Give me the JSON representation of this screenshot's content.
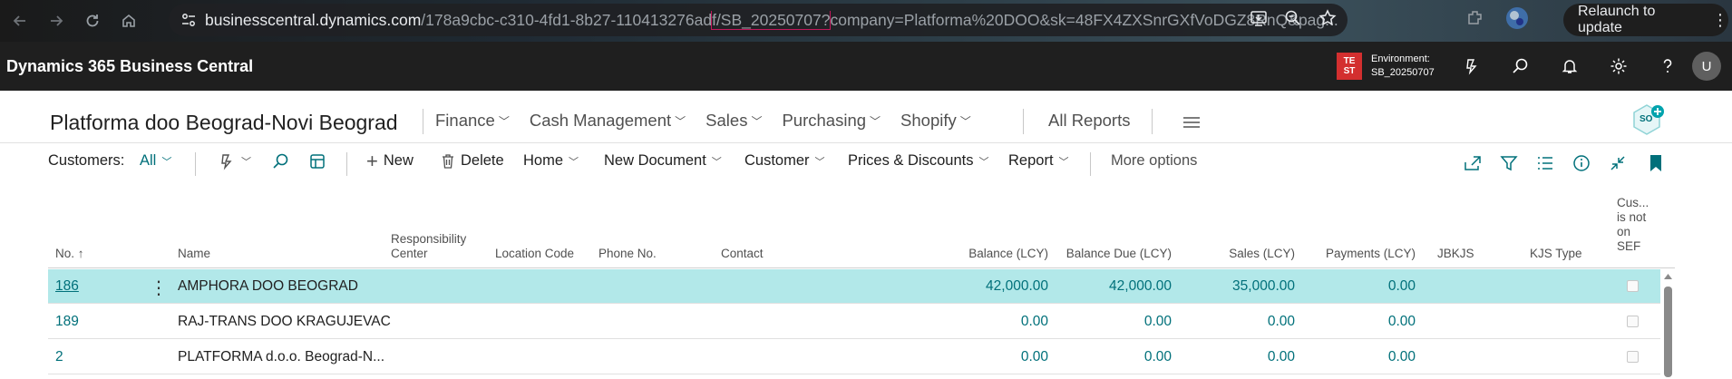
{
  "browser": {
    "url_host": "businesscentral.dynamics.com",
    "url_path_pre": "/178a9cbc-c310-4fd1-8b27-110413276ad",
    "url_highlight": "f/SB_20250707?",
    "url_path_post": "company=Platforma%20DOO&sk=48FX4ZXSnrGXfVoDGZ8RnQ&pag...",
    "relaunch_label": "Relaunch to update"
  },
  "appbar": {
    "app_name": "Dynamics 365 Business Central",
    "env_badge_line1": "TE",
    "env_badge_line2": "ST",
    "env_label": "Environment:",
    "env_name": "SB_20250707",
    "avatar_letter": "U"
  },
  "company_nav": {
    "company": "Platforma doo Beograd-Novi Beograd",
    "menu": [
      "Finance",
      "Cash Management",
      "Sales",
      "Purchasing",
      "Shopify"
    ],
    "all_reports": "All Reports",
    "badge": "SO"
  },
  "actionbar": {
    "title": "Customers:",
    "filter": "All",
    "new": "New",
    "delete": "Delete",
    "home": "Home",
    "new_document": "New Document",
    "customer": "Customer",
    "prices_discounts": "Prices & Discounts",
    "report": "Report",
    "more_options": "More options"
  },
  "columns": {
    "no": "No. ↑",
    "name": "Name",
    "resp_center_1": "Responsibility",
    "resp_center_2": "Center",
    "location": "Location Code",
    "phone": "Phone No.",
    "contact": "Contact",
    "balance": "Balance (LCY)",
    "balance_due": "Balance Due (LCY)",
    "sales": "Sales (LCY)",
    "payments": "Payments (LCY)",
    "jbkjs": "JBKJS",
    "kjs_type": "KJS Type",
    "sef_1": "Cus...",
    "sef_2": "is not",
    "sef_3": "on",
    "sef_4": "SEF"
  },
  "rows": [
    {
      "no": "186",
      "name": "AMPHORA DOO BEOGRAD",
      "balance": "42,000.00",
      "balance_due": "42,000.00",
      "sales": "35,000.00",
      "payments": "0.00"
    },
    {
      "no": "189",
      "name": "RAJ-TRANS DOO KRAGUJEVAC",
      "balance": "0.00",
      "balance_due": "0.00",
      "sales": "0.00",
      "payments": "0.00"
    },
    {
      "no": "2",
      "name": "PLATFORMA d.o.o. Beograd-N...",
      "balance": "0.00",
      "balance_due": "0.00",
      "sales": "0.00",
      "payments": "0.00"
    }
  ],
  "colors": {
    "accent": "#00707a",
    "selected_row": "#b2e8e9",
    "env_badge": "#d32f2f"
  }
}
